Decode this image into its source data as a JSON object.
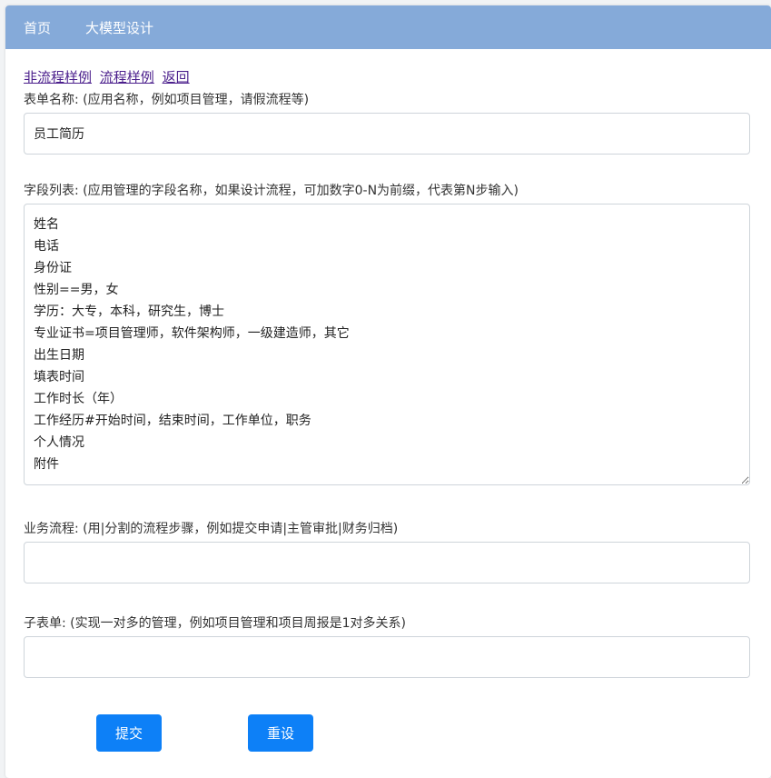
{
  "nav": {
    "home_label": "首页",
    "llm_design_label": "大模型设计"
  },
  "links": {
    "non_flow_sample": "非流程样例",
    "flow_sample": "流程样例",
    "back": "返回"
  },
  "form": {
    "form_name_label": "表单名称: (应用名称，例如项目管理，请假流程等)",
    "form_name_value": "员工简历",
    "fields_label": "字段列表: (应用管理的字段名称，如果设计流程，可加数字0-N为前缀，代表第N步输入)",
    "fields_value": "姓名\n电话\n身份证\n性别==男，女\n学历：大专，本科，研究生，博士\n专业证书=项目管理师，软件架构师，一级建造师，其它\n出生日期\n填表时间\n工作时长（年）\n工作经历#开始时间，结束时间，工作单位，职务\n个人情况\n附件",
    "workflow_label": "业务流程: (用|分割的流程步骤，例如提交申请|主管审批|财务归档)",
    "workflow_value": "",
    "subform_label": "子表单: (实现一对多的管理，例如项目管理和项目周报是1对多关系)",
    "subform_value": ""
  },
  "buttons": {
    "submit_label": "提交",
    "reset_label": "重设"
  },
  "colors": {
    "navbar": "#85aad9",
    "button": "#0d80f7",
    "link": "#4b1f8c"
  }
}
